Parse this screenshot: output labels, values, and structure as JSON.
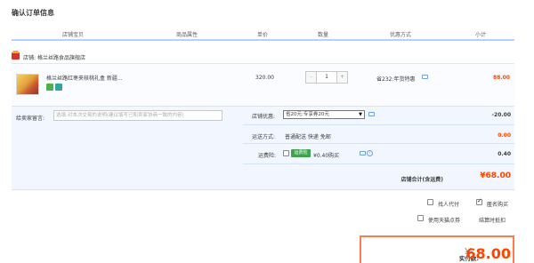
{
  "page": {
    "title": "确认订单信息"
  },
  "columns": [
    "店铺宝贝",
    "商品属性",
    "单价",
    "数量",
    "优惠方式",
    "小计"
  ],
  "shop": {
    "prefix": "店铺:",
    "name": "格兰丝路食品旗舰店"
  },
  "item": {
    "name": "格兰丝路红枣夹核桃礼盒 新疆...",
    "price": "320.00",
    "quantity": "1",
    "qty_minus": "-",
    "qty_plus": "+",
    "promo": "省232:年货特惠",
    "subtotal": "88.00"
  },
  "message": {
    "label": "给卖家留言:",
    "placeholder": "选填:对本次交易的说明(建议填写已和卖家协商一致的内容)"
  },
  "shop_promo": {
    "label": "店铺优惠:",
    "selected": "省20元:专享券20元",
    "amount": "-20.00"
  },
  "shipping": {
    "label": "运送方式:",
    "value": "普通配送 快递 免邮",
    "amount": "0.00"
  },
  "insurance": {
    "label": "运费险:",
    "pill": "运费险",
    "value": "¥0.40购买",
    "amount": "0.40"
  },
  "shop_total": {
    "label": "店铺合计(含运费)",
    "value": "¥68.00"
  },
  "options": {
    "proxy_pay": "找人代付",
    "anonymous": "匿名购买",
    "points": "使用天猫点券",
    "points_status": "结算时抵扣"
  },
  "payment": {
    "label": "实付款:",
    "currency": "¥",
    "value": "68.00"
  },
  "colors": {
    "accent": "#ff4400",
    "header_line": "#b2d1ff",
    "panel_bg": "#f2f7ff"
  }
}
